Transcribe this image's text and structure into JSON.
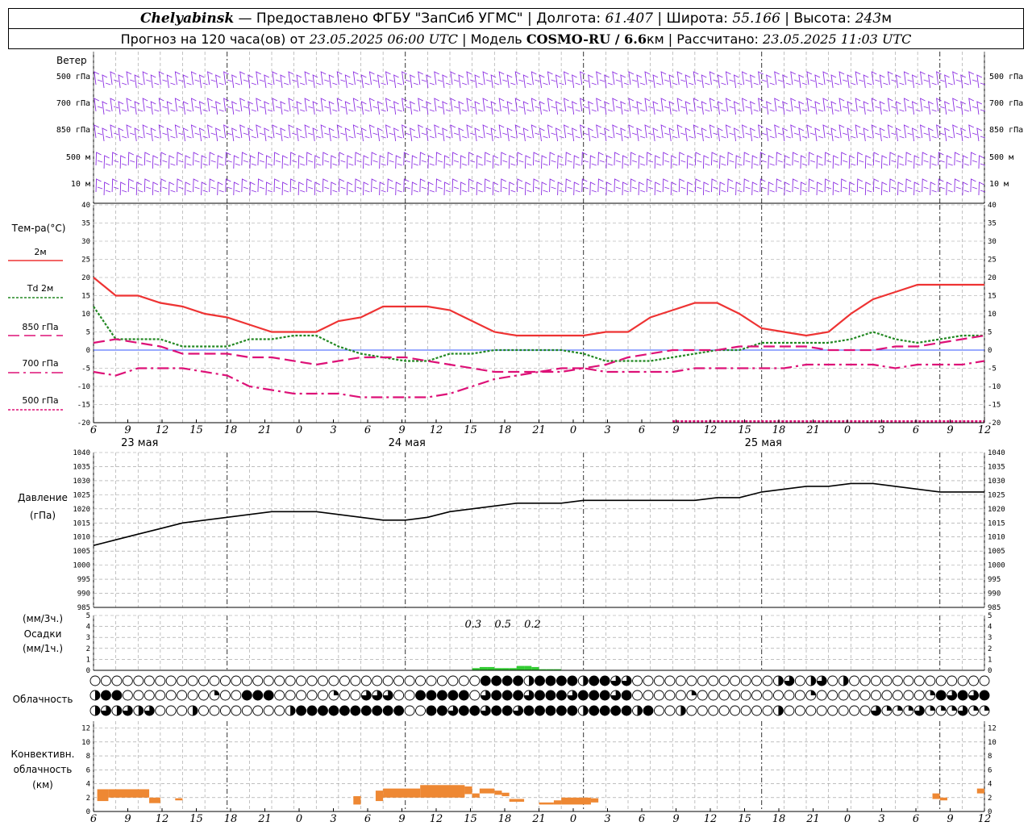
{
  "header": {
    "city": "Chelyabinsk",
    "provider": "— Предоставлено ФГБУ \"ЗапСиб УГМС\"",
    "lon_label": "Долгота:",
    "lon": "61.407",
    "lat_label": "Широта:",
    "lat": "55.166",
    "alt_label": "Высота:",
    "alt": "243",
    "alt_unit": "м",
    "forecast_label": "Прогноз на 120 часа(ов) от",
    "forecast_start": "23.05.2025 06:00 UTC",
    "model_label": "Модель",
    "model": "COSMO-RU / 6.6",
    "model_unit": "км",
    "calc_label": "Рассчитано:",
    "calc_time": "23.05.2025 11:03 UTC"
  },
  "colors": {
    "wind": "#8a2be2",
    "t2m": "#ee3333",
    "td2m": "#228822",
    "t850": "#dd1177",
    "t700": "#dd1177",
    "t500": "#dd1177",
    "pressure": "#000000",
    "precip": "#33cc33",
    "convective": "#ee8833",
    "grid": "#999999"
  },
  "wind_panel": {
    "title": "Ветер",
    "levels": [
      "500 гПа",
      "700 гПа",
      "850 гПа",
      "500 м",
      "10 м"
    ]
  },
  "temp_panel": {
    "title": "Тем-ра(°C)",
    "legend": [
      {
        "label": "2м",
        "style": "solid"
      },
      {
        "label": "Td  2м",
        "style": "dotted"
      },
      {
        "label": "850 гПа",
        "style": "dash"
      },
      {
        "label": "700 гПа",
        "style": "dashdot"
      },
      {
        "label": "500 гПа",
        "style": "dotted"
      }
    ]
  },
  "pressure_panel": {
    "title": "Давление",
    "unit": "(гПа)"
  },
  "precip_panel": {
    "unit3h": "(мм/3ч.)",
    "title": "Осадки",
    "unit1h": "(мм/1ч.)",
    "annotations": [
      "0.3",
      "0.5",
      "0.2"
    ]
  },
  "cloud_panel": {
    "title": "Облачность"
  },
  "conv_panel": {
    "title": "Конвективн.",
    "title2": "облачность",
    "unit": "(км)"
  },
  "time_axis": {
    "hour_ticks": [
      "6",
      "9",
      "12",
      "15",
      "18",
      "21",
      "0",
      "3",
      "6",
      "9",
      "12",
      "15",
      "18",
      "21",
      "0",
      "3",
      "6",
      "9",
      "12",
      "15",
      "18",
      "21",
      "0",
      "3",
      "6",
      "9",
      "12"
    ],
    "dates": [
      "23 мая",
      "24 мая",
      "25 мая"
    ]
  },
  "chart_data": [
    {
      "type": "line",
      "title": "Тем-ра(°C)",
      "x_hours": [
        0,
        3,
        6,
        9,
        12,
        15,
        18,
        21,
        24,
        27,
        30,
        33,
        36,
        39,
        42,
        45,
        48,
        51,
        54,
        57,
        60,
        63,
        66,
        69,
        72,
        75,
        78,
        81,
        84,
        87,
        90,
        93,
        96,
        99,
        102,
        105,
        108,
        111,
        114,
        117,
        120
      ],
      "ylim": [
        -20,
        40
      ],
      "yticks": [
        -20,
        -15,
        -10,
        -5,
        0,
        5,
        10,
        15,
        20,
        25,
        30,
        35,
        40
      ],
      "series": [
        {
          "name": "2м",
          "values": [
            20,
            15,
            15,
            13,
            12,
            10,
            9,
            7,
            5,
            5,
            5,
            8,
            9,
            12,
            12,
            12,
            11,
            8,
            5,
            4,
            4,
            4,
            4,
            5,
            5,
            9,
            11,
            13,
            13,
            10,
            6,
            5,
            4,
            5,
            10,
            14,
            16,
            18,
            18,
            18,
            18
          ]
        },
        {
          "name": "Td 2м",
          "values": [
            12,
            3,
            3,
            3,
            1,
            1,
            1,
            3,
            3,
            4,
            4,
            1,
            -1,
            -2,
            -3,
            -3,
            -1,
            -1,
            0,
            0,
            0,
            0,
            -1,
            -3,
            -3,
            -3,
            -2,
            -1,
            0,
            0,
            2,
            2,
            2,
            2,
            3,
            5,
            3,
            2,
            3,
            4,
            4
          ]
        },
        {
          "name": "850 гПа",
          "values": [
            2,
            3,
            2,
            1,
            -1,
            -1,
            -1,
            -2,
            -2,
            -3,
            -4,
            -3,
            -2,
            -2,
            -2,
            -3,
            -4,
            -5,
            -6,
            -6,
            -6,
            -5,
            -5,
            -4,
            -2,
            -1,
            0,
            0,
            0,
            1,
            1,
            1,
            1,
            0,
            0,
            0,
            1,
            1,
            2,
            3,
            4
          ]
        },
        {
          "name": "700 гПа",
          "values": [
            -6,
            -7,
            -5,
            -5,
            -5,
            -6,
            -7,
            -10,
            -11,
            -12,
            -12,
            -12,
            -13,
            -13,
            -13,
            -13,
            -12,
            -10,
            -8,
            -7,
            -6,
            -6,
            -5,
            -6,
            -6,
            -6,
            -6,
            -5,
            -5,
            -5,
            -5,
            -5,
            -4,
            -4,
            -4,
            -4,
            -5,
            -4,
            -4,
            -4,
            -3
          ]
        },
        {
          "name": "500 гПа",
          "values": [
            null,
            null,
            null,
            null,
            null,
            null,
            null,
            null,
            null,
            null,
            null,
            null,
            null,
            null,
            null,
            null,
            null,
            null,
            null,
            null,
            null,
            null,
            null,
            null,
            null,
            null,
            -20,
            -20,
            -20,
            -20,
            -20,
            -20,
            -20,
            -20,
            -20,
            -20,
            -20,
            -20,
            -20,
            -20,
            -20
          ]
        }
      ]
    },
    {
      "type": "line",
      "title": "Давление",
      "ylabel": "(гПа)",
      "ylim": [
        985,
        1040
      ],
      "yticks": [
        985,
        990,
        995,
        1000,
        1005,
        1010,
        1015,
        1020,
        1025,
        1030,
        1035,
        1040
      ],
      "x_hours": [
        0,
        3,
        6,
        9,
        12,
        15,
        18,
        21,
        24,
        27,
        30,
        33,
        36,
        39,
        42,
        45,
        48,
        51,
        54,
        57,
        60,
        63,
        66,
        69,
        72,
        75,
        78,
        81,
        84,
        87,
        90,
        93,
        96,
        99,
        102,
        105,
        108,
        111,
        114,
        117,
        120
      ],
      "series": [
        {
          "name": "Давление",
          "values": [
            1007,
            1009,
            1011,
            1013,
            1015,
            1016,
            1017,
            1018,
            1019,
            1019,
            1019,
            1018,
            1017,
            1016,
            1016,
            1017,
            1019,
            1020,
            1021,
            1022,
            1022,
            1022,
            1023,
            1023,
            1023,
            1023,
            1023,
            1023,
            1024,
            1024,
            1026,
            1027,
            1028,
            1028,
            1029,
            1029,
            1028,
            1027,
            1026,
            1026,
            1026
          ]
        }
      ]
    },
    {
      "type": "bar",
      "title": "Осадки",
      "ylim": [
        0,
        5
      ],
      "yticks": [
        0,
        1,
        2,
        3,
        4,
        5
      ],
      "x_hours": [
        51,
        52,
        53,
        54,
        55,
        56,
        57,
        58,
        59,
        60,
        61,
        62
      ],
      "series": [
        {
          "name": "Осадки",
          "values": [
            0.2,
            0.3,
            0.3,
            0.2,
            0.2,
            0.2,
            0.4,
            0.4,
            0.3,
            0.1,
            0.1,
            0.1
          ]
        }
      ]
    },
    {
      "type": "bar",
      "title": "Конвективн. облачность",
      "ylabel": "(км)",
      "ylim": [
        0,
        13
      ],
      "yticks": [
        0,
        2,
        4,
        6,
        8,
        10,
        12
      ],
      "bars": [
        {
          "x0": 0.5,
          "x1": 2,
          "lo": 1.5,
          "hi": 3.2
        },
        {
          "x0": 2,
          "x1": 7.5,
          "lo": 2.0,
          "hi": 3.2
        },
        {
          "x0": 7.5,
          "x1": 9,
          "lo": 1.2,
          "hi": 2.0
        },
        {
          "x0": 11,
          "x1": 12,
          "lo": 1.6,
          "hi": 1.9
        },
        {
          "x0": 35,
          "x1": 36,
          "lo": 1.0,
          "hi": 2.2
        },
        {
          "x0": 38,
          "x1": 39,
          "lo": 1.5,
          "hi": 3.0
        },
        {
          "x0": 39,
          "x1": 44,
          "lo": 2.0,
          "hi": 3.3
        },
        {
          "x0": 44,
          "x1": 50,
          "lo": 2.0,
          "hi": 3.8
        },
        {
          "x0": 50,
          "x1": 51,
          "lo": 2.5,
          "hi": 3.6
        },
        {
          "x0": 51,
          "x1": 52,
          "lo": 2.0,
          "hi": 2.6
        },
        {
          "x0": 52,
          "x1": 54,
          "lo": 2.6,
          "hi": 3.3
        },
        {
          "x0": 54,
          "x1": 55,
          "lo": 2.4,
          "hi": 3.0
        },
        {
          "x0": 55,
          "x1": 56,
          "lo": 2.2,
          "hi": 2.7
        },
        {
          "x0": 56,
          "x1": 58,
          "lo": 1.4,
          "hi": 1.8
        },
        {
          "x0": 60,
          "x1": 62,
          "lo": 1.0,
          "hi": 1.3
        },
        {
          "x0": 62,
          "x1": 63,
          "lo": 1.0,
          "hi": 1.6
        },
        {
          "x0": 63,
          "x1": 67,
          "lo": 1.0,
          "hi": 2.0
        },
        {
          "x0": 67,
          "x1": 68,
          "lo": 1.3,
          "hi": 1.9
        },
        {
          "x0": 113,
          "x1": 114,
          "lo": 1.8,
          "hi": 2.6
        },
        {
          "x0": 114,
          "x1": 115,
          "lo": 1.6,
          "hi": 2.0
        },
        {
          "x0": 119,
          "x1": 120,
          "lo": 2.6,
          "hi": 3.3
        }
      ]
    }
  ]
}
